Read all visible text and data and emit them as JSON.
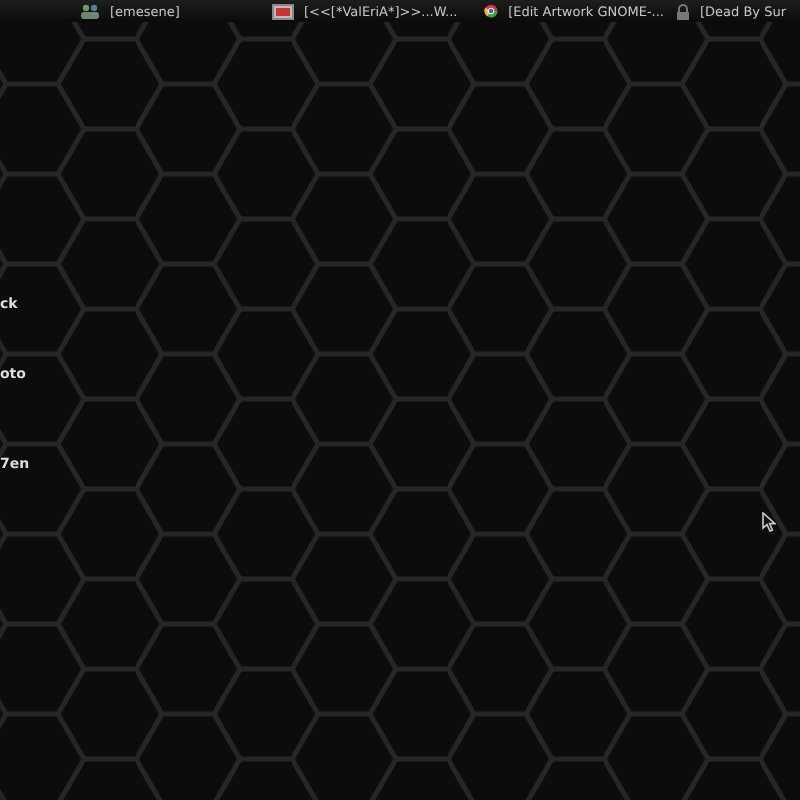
{
  "taskbar": {
    "tasks": [
      {
        "label": "[emesene]",
        "kind": "people"
      },
      {
        "label": "[<<[*ValEriA*]>>...W...",
        "kind": "window"
      },
      {
        "label": "[Edit Artwork GNOME-...",
        "kind": "browser"
      },
      {
        "label": "[Dead By Sur",
        "kind": "lock"
      }
    ]
  },
  "desktop": {
    "icon_labels": [
      "ck",
      "oto",
      "7en"
    ]
  }
}
